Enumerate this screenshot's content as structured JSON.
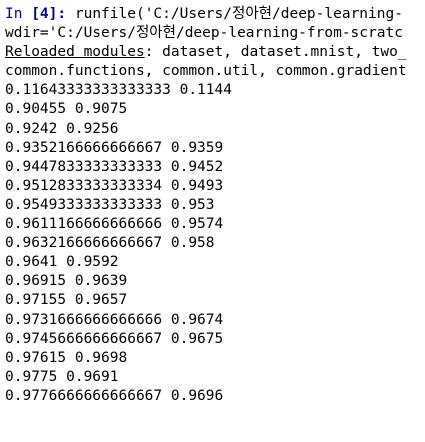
{
  "console": {
    "prompt_in": "In ",
    "prompt_num": "[4]: ",
    "command_line_1": "runfile('C:/Users/정아현/deep-learning-",
    "command_line_2": "wdir='C:/Users/정아현/deep-learning-from-scratc",
    "reloaded_label": "Reloaded modules",
    "reloaded_rest": ": dataset, dataset.mnist, two_",
    "reloaded_line_2": "common.functions, common.util, common.gradient",
    "output_lines": [
      "0.11643333333333333 0.1144",
      "0.90455 0.9075",
      "0.9242 0.9256",
      "0.9352166666666667 0.9359",
      "0.9447833333333333 0.9452",
      "0.9512833333333334 0.9493",
      "0.9549333333333333 0.953",
      "0.9611166666666666 0.9574",
      "0.9632166666666667 0.958",
      "0.9641 0.9592",
      "0.96915 0.9639",
      "0.97155 0.9657",
      "0.9731666666666666 0.9674",
      "0.9745666666666667 0.9675",
      "0.97615 0.9698",
      "0.9775 0.9691",
      "0.9776666666666667 0.9696"
    ]
  }
}
